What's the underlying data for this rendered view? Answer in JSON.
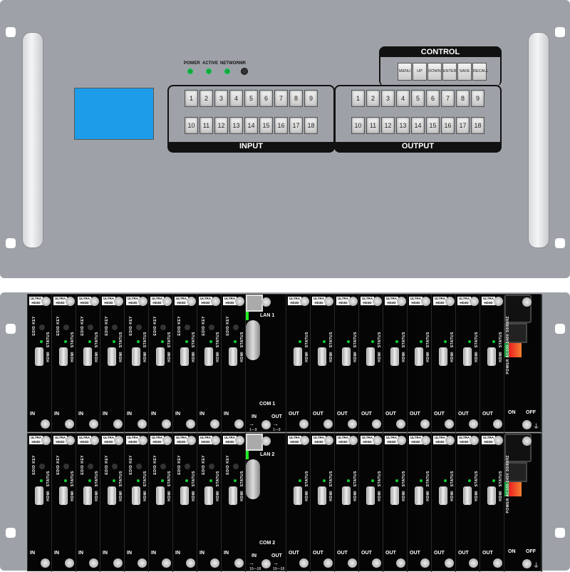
{
  "front": {
    "leds": [
      {
        "label": "POWER",
        "color": "#1aa33a"
      },
      {
        "label": "ACTIVE",
        "color": "#1aa33a"
      },
      {
        "label": "NETWORK",
        "color": "#1aa33a"
      },
      {
        "label": "IR",
        "color": "#333333"
      }
    ],
    "lcd_color": "#1d9ce9",
    "control": {
      "title": "CONTROL",
      "buttons": [
        "MENU",
        "UP",
        "DOWN",
        "ENTER",
        "SAVE",
        "RECALL"
      ]
    },
    "input": {
      "title": "INPUT",
      "buttons": [
        "1",
        "2",
        "3",
        "4",
        "5",
        "6",
        "7",
        "8",
        "9",
        "10",
        "11",
        "12",
        "13",
        "14",
        "15",
        "16",
        "17",
        "18"
      ]
    },
    "output": {
      "title": "OUTPUT",
      "buttons": [
        "1",
        "2",
        "3",
        "4",
        "5",
        "6",
        "7",
        "8",
        "9",
        "10",
        "11",
        "12",
        "13",
        "14",
        "15",
        "16",
        "17",
        "18"
      ]
    }
  },
  "rear": {
    "logo": "ULTRA HD3D",
    "card_labels": {
      "edid": "EDID KEY",
      "status": "STATUS",
      "hdmi": "HDMI",
      "in": "IN",
      "out": "OUT"
    },
    "modules": [
      {
        "lan": "LAN 1",
        "com": "COM 1",
        "in": "IN",
        "out": "OUT",
        "in_range": "1—9",
        "out_range": "1—9"
      },
      {
        "lan": "LAN 2",
        "com": "COM 2",
        "in": "IN",
        "out": "OUT",
        "in_range": "10—18",
        "out_range": "10—18"
      }
    ],
    "power": {
      "label": "POWER AC100-240V 50/60HZ",
      "on": "ON",
      "off": "OFF"
    }
  }
}
